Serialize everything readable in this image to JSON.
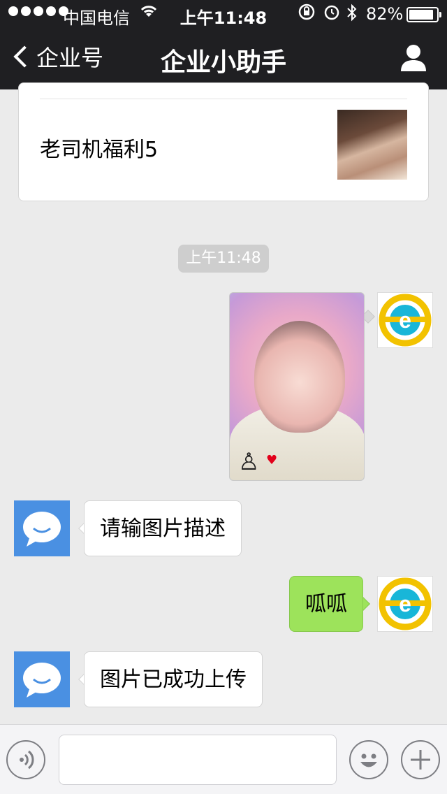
{
  "status_bar": {
    "carrier": "中国电信",
    "time": "上午11:48",
    "battery_percent": "82%",
    "battery_level": 0.82
  },
  "nav": {
    "back_label": "企业号",
    "title": "企业小助手"
  },
  "article_card": {
    "headline": "老司机福利5"
  },
  "timestamp": "上午11:48",
  "messages": [
    {
      "sender": "me",
      "type": "image"
    },
    {
      "sender": "bot",
      "type": "text",
      "text": "请输图片描述"
    },
    {
      "sender": "me",
      "type": "text",
      "text": "呱呱"
    },
    {
      "sender": "bot",
      "type": "text",
      "text": "图片已成功上传"
    }
  ],
  "input_bar": {
    "placeholder": ""
  },
  "colors": {
    "nav_bg": "#1f1f22",
    "chat_bg": "#ebebeb",
    "bubble_me": "#9de35b",
    "bubble_bot": "#ffffff",
    "bot_avatar": "#4a90e2",
    "e_logo_ring": "#f2c200",
    "e_logo_center": "#18b6d8"
  }
}
